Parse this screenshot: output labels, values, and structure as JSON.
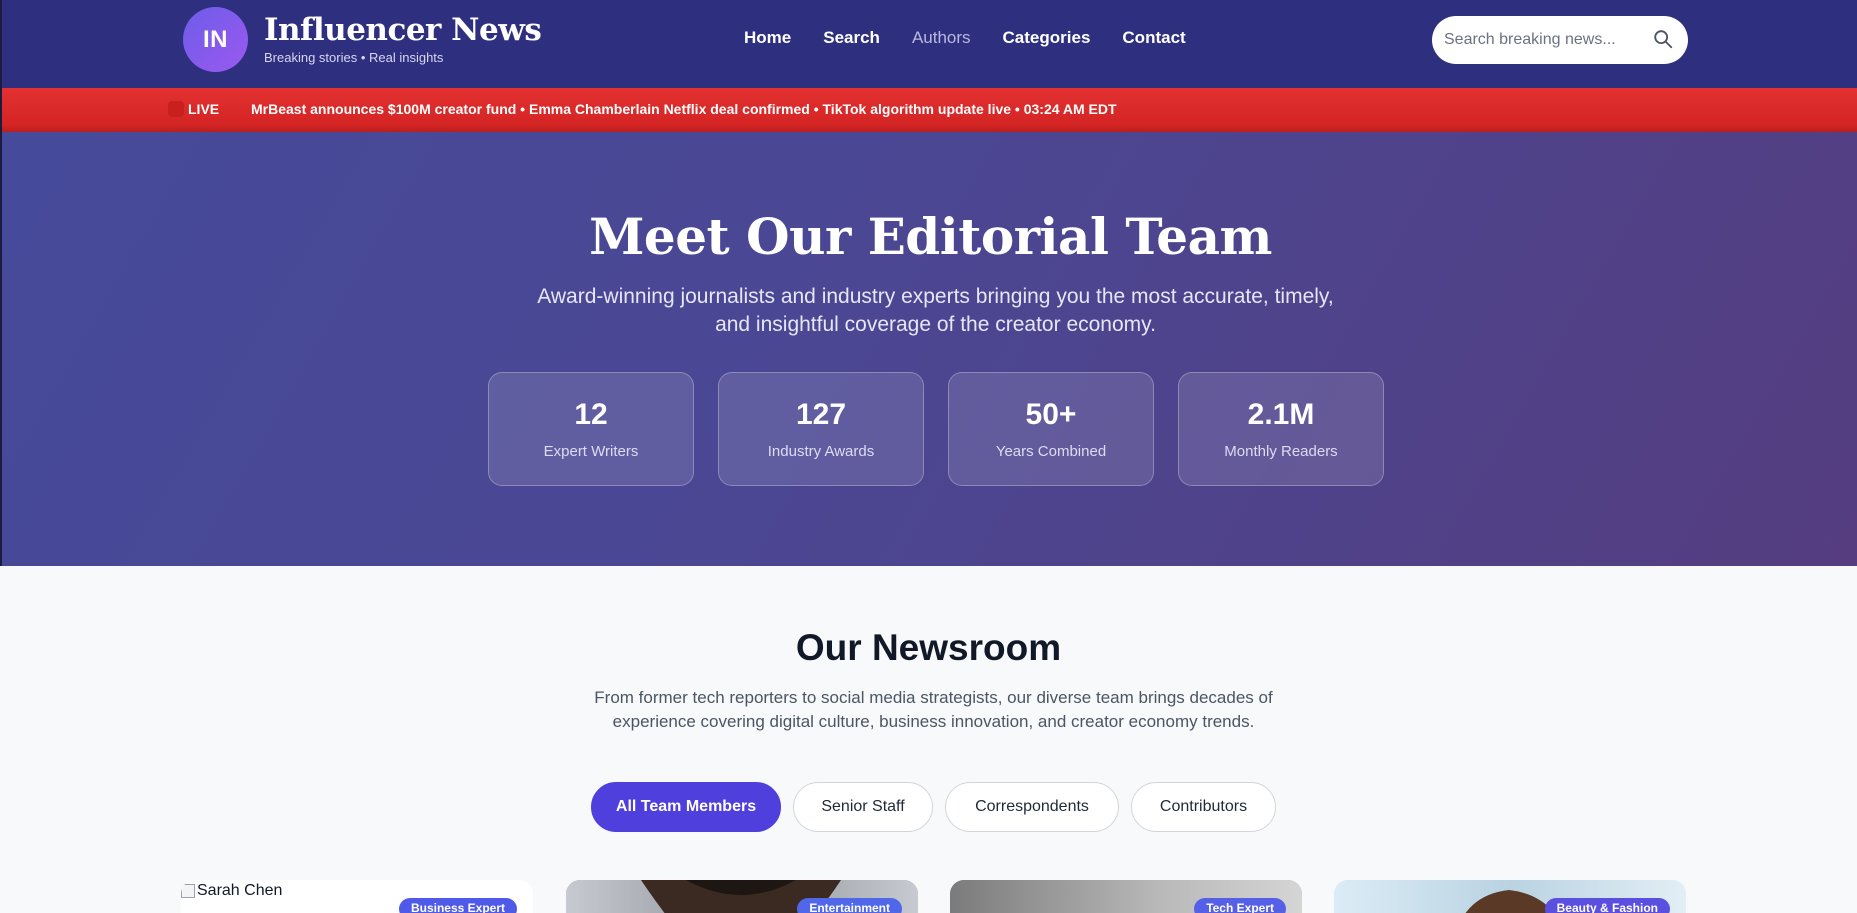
{
  "brand": {
    "logo_initials": "IN",
    "name": "Influencer News",
    "tagline": "Breaking stories • Real insights"
  },
  "nav": {
    "items": [
      {
        "label": "Home"
      },
      {
        "label": "Search"
      },
      {
        "label": "Authors"
      },
      {
        "label": "Categories"
      },
      {
        "label": "Contact"
      }
    ]
  },
  "search": {
    "placeholder": "Search breaking news...",
    "icon": "search-icon"
  },
  "ticker": {
    "live_label": "LIVE",
    "text": "MrBeast announces $100M creator fund • Emma Chamberlain Netflix deal confirmed • TikTok algorithm update live • 03:24 AM EDT"
  },
  "hero": {
    "title": "Meet Our Editorial Team",
    "subtitle": "Award-winning journalists and industry experts bringing you the most accurate, timely, and insightful coverage of the creator economy.",
    "stats": [
      {
        "value": "12",
        "label": "Expert Writers"
      },
      {
        "value": "127",
        "label": "Industry Awards"
      },
      {
        "value": "50+",
        "label": "Years Combined"
      },
      {
        "value": "2.1M",
        "label": "Monthly Readers"
      }
    ]
  },
  "newsroom": {
    "title": "Our Newsroom",
    "subtitle": "From former tech reporters to social media strategists, our diverse team brings decades of experience covering digital culture, business innovation, and creator economy trends.",
    "filters": [
      {
        "label": "All Team Members",
        "active": true
      },
      {
        "label": "Senior Staff",
        "active": false
      },
      {
        "label": "Correspondents",
        "active": false
      },
      {
        "label": "Contributors",
        "active": false
      }
    ]
  },
  "cards": [
    {
      "image_alt": "Sarah Chen",
      "badge": "Business Expert"
    },
    {
      "image_alt": "",
      "badge": "Entertainment"
    },
    {
      "image_alt": "",
      "badge": "Tech Expert"
    },
    {
      "image_alt": "",
      "badge": "Beauty & Fashion"
    }
  ],
  "colors": {
    "header_bg": "#2f2f7f",
    "ticker_red": "#d42424",
    "accent_purple": "#4f3fdc",
    "badge_blue": "#4f46e5"
  }
}
